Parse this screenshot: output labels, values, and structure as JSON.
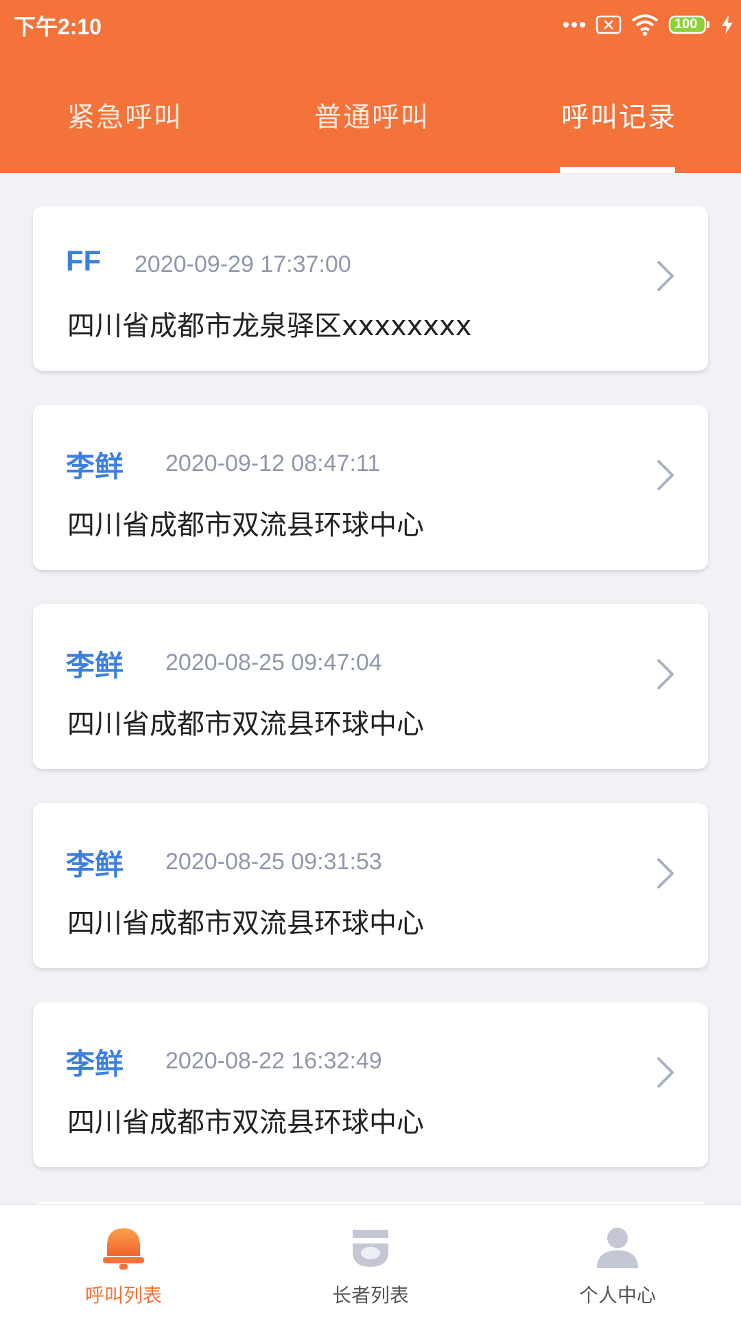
{
  "status_bar": {
    "time": "下午2:10",
    "battery": "100"
  },
  "tabs": [
    {
      "label": "紧急呼叫",
      "active": false
    },
    {
      "label": "普通呼叫",
      "active": false
    },
    {
      "label": "呼叫记录",
      "active": true
    }
  ],
  "records": [
    {
      "name": "FF",
      "time": "2020-09-29 17:37:00",
      "address": "四川省成都市龙泉驿区xxxxxxxx"
    },
    {
      "name": "李鲜",
      "time": "2020-09-12 08:47:11",
      "address": "四川省成都市双流县环球中心"
    },
    {
      "name": "李鲜",
      "time": "2020-08-25 09:47:04",
      "address": "四川省成都市双流县环球中心"
    },
    {
      "name": "李鲜",
      "time": "2020-08-25 09:31:53",
      "address": "四川省成都市双流县环球中心"
    },
    {
      "name": "李鲜",
      "time": "2020-08-22 16:32:49",
      "address": "四川省成都市双流县环球中心"
    }
  ],
  "bottom_nav": [
    {
      "label": "呼叫列表",
      "icon": "bell-icon",
      "active": true
    },
    {
      "label": "长者列表",
      "icon": "camera-icon",
      "active": false
    },
    {
      "label": "个人中心",
      "icon": "person-icon",
      "active": false
    }
  ],
  "colors": {
    "brand": "#f3733a",
    "name_blue": "#3c7fe0",
    "timestamp_gray": "#8f98ab",
    "background": "#f1f2f6"
  }
}
